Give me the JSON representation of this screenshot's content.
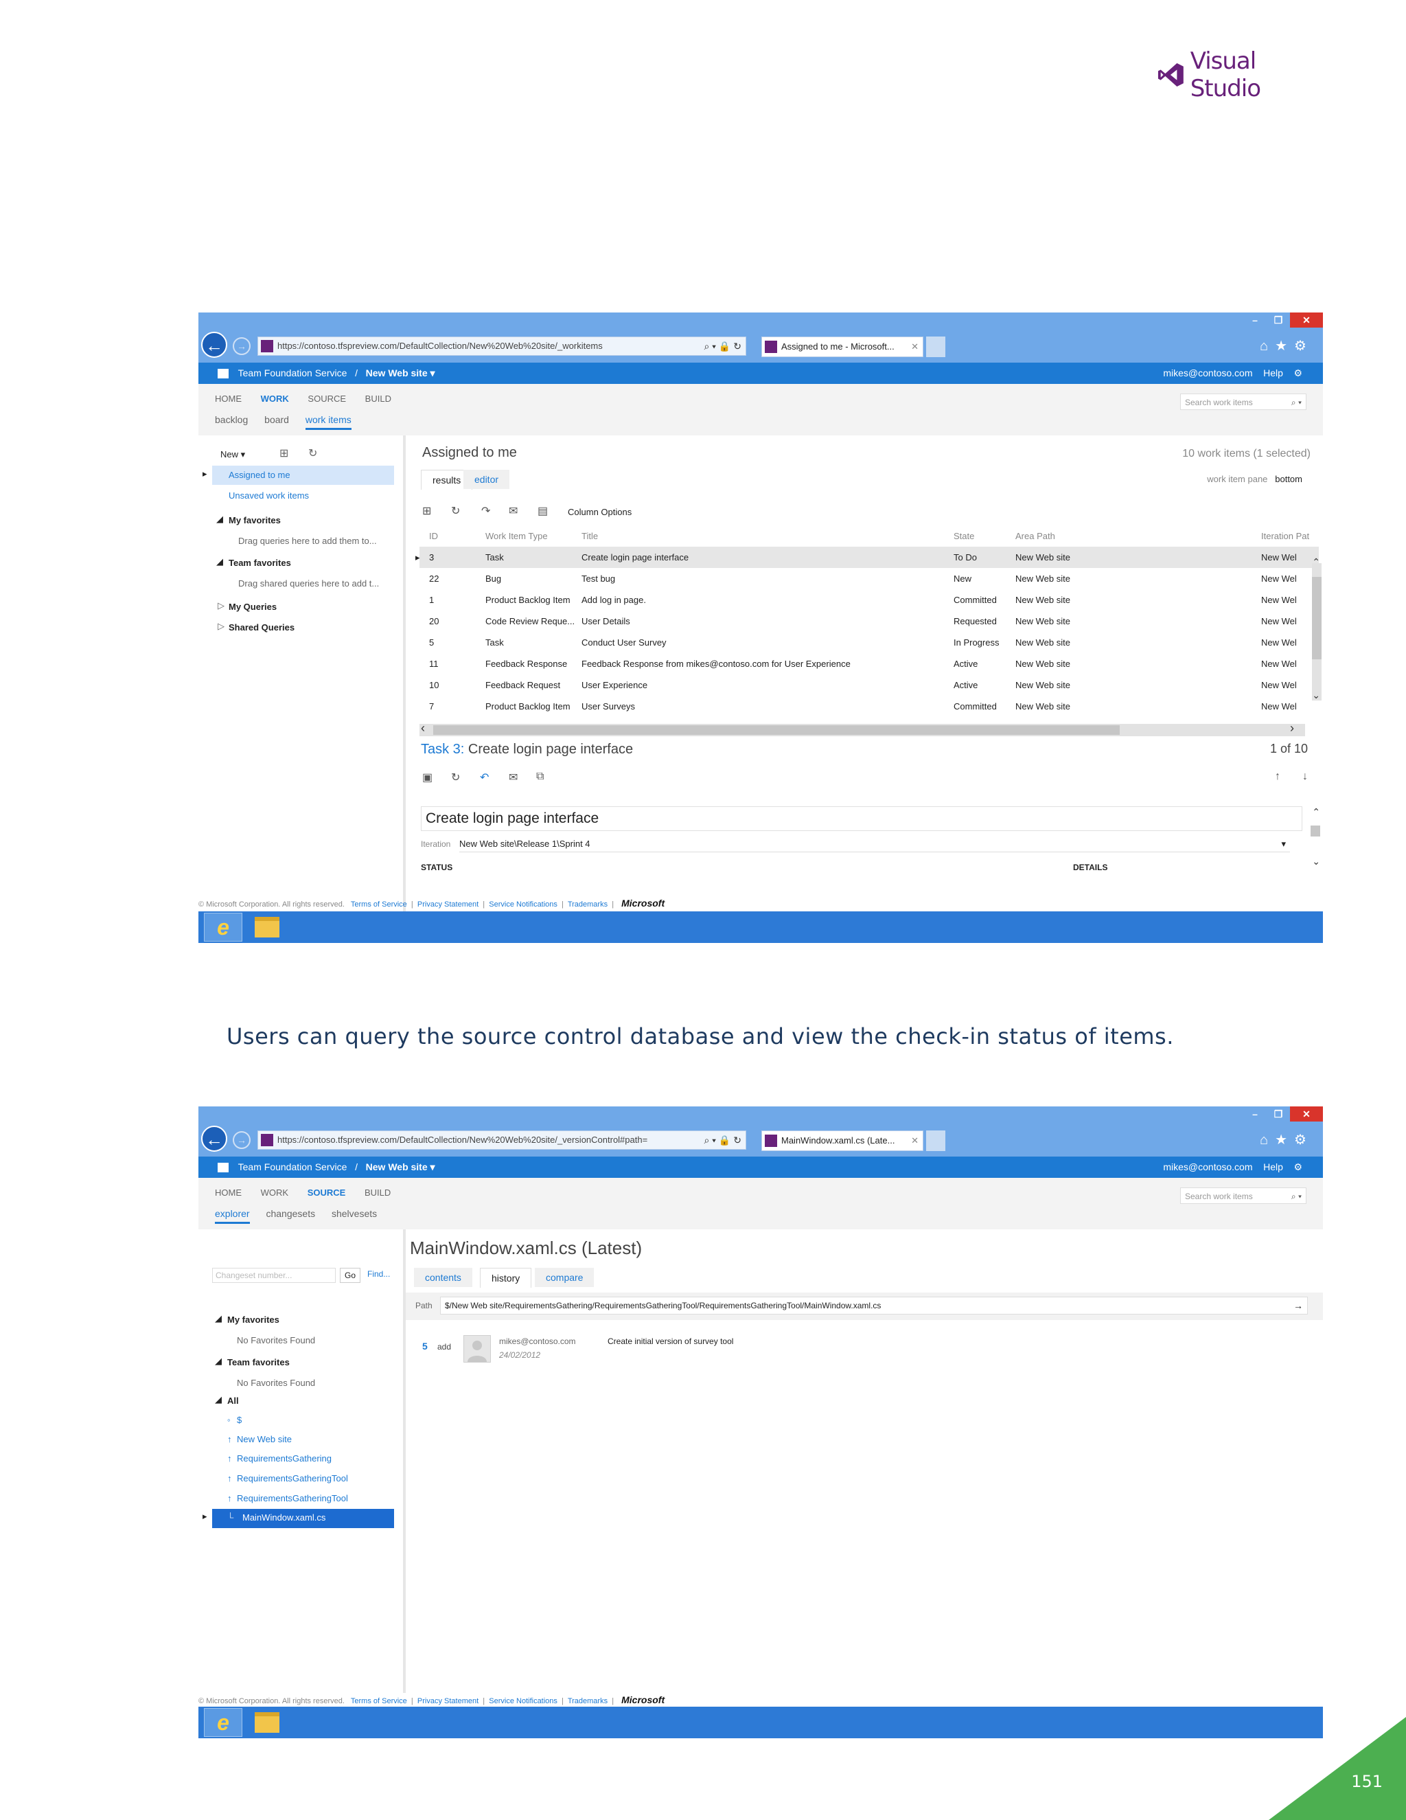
{
  "brand": {
    "name": "Visual Studio",
    "color": "#68217a"
  },
  "caption": "Users can query the source control database and view the check-in status of items.",
  "page_number": "151",
  "colors": {
    "accent": "#1d7ad3",
    "corner": "#4caf50",
    "taskbar": "#2d7ad6"
  },
  "shot1": {
    "address": "https://contoso.tfspreview.com/DefaultCollection/New%20Web%20site/_workitems",
    "tab_title": "Assigned to me - Microsoft...",
    "tfs_title": "Team Foundation Service",
    "sep": "/",
    "project": "New Web site ▾",
    "user": "mikes@contoso.com",
    "help": "Help",
    "topnav": [
      "HOME",
      "WORK",
      "SOURCE",
      "BUILD"
    ],
    "subnav": [
      "backlog",
      "board",
      "work items"
    ],
    "search_placeholder": "Search work items",
    "left": {
      "new_label": "New ▾",
      "assigned": "Assigned to me",
      "unsaved": "Unsaved work items",
      "my_favorites": "My favorites",
      "my_fav_hint": "Drag queries here to add them to...",
      "team_favorites": "Team favorites",
      "team_fav_hint": "Drag shared queries here to add t...",
      "my_queries": "My Queries",
      "shared_queries": "Shared Queries"
    },
    "query_title": "Assigned to me",
    "count_text": "10 work items (1 selected)",
    "tabs": [
      "results",
      "editor"
    ],
    "pane_label": "work item pane",
    "pane_value": "bottom",
    "column_options": "Column Options",
    "columns": [
      "ID",
      "Work Item Type",
      "Title",
      "State",
      "Area Path",
      "Iteration Pat"
    ],
    "rows": [
      [
        "3",
        "Task",
        "Create login page interface",
        "To Do",
        "New Web site",
        "New Wel"
      ],
      [
        "22",
        "Bug",
        "Test bug",
        "New",
        "New Web site",
        "New Wel"
      ],
      [
        "1",
        "Product Backlog Item",
        "Add log in page.",
        "Committed",
        "New Web site",
        "New Wel"
      ],
      [
        "20",
        "Code Review Reque...",
        "User Details",
        "Requested",
        "New Web site",
        "New Wel"
      ],
      [
        "5",
        "Task",
        "Conduct User Survey",
        "In Progress",
        "New Web site",
        "New Wel"
      ],
      [
        "11",
        "Feedback Response",
        "Feedback Response from mikes@contoso.com for User Experience",
        "Active",
        "New Web site",
        "New Wel"
      ],
      [
        "10",
        "Feedback Request",
        "User Experience",
        "Active",
        "New Web site",
        "New Wel"
      ],
      [
        "7",
        "Product Backlog Item",
        "User Surveys",
        "Committed",
        "New Web site",
        "New Wel"
      ]
    ],
    "detail_prefix": "Task 3:",
    "detail_title": "Create login page interface",
    "detail_pos": "1 of 10",
    "field_title": "Create login page interface",
    "iteration_label": "Iteration",
    "iteration_value": "New Web site\\Release 1\\Sprint 4",
    "status_label": "STATUS",
    "details_label": "DETAILS",
    "footer": {
      "copyright": "© Microsoft Corporation. All rights reserved.",
      "links": [
        "Terms of Service",
        "Privacy Statement",
        "Service Notifications",
        "Trademarks"
      ],
      "ms": "Microsoft"
    }
  },
  "shot2": {
    "address": "https://contoso.tfspreview.com/DefaultCollection/New%20Web%20site/_versionControl#path=",
    "tab_title": "MainWindow.xaml.cs (Late...",
    "topnav": [
      "HOME",
      "WORK",
      "SOURCE",
      "BUILD"
    ],
    "subnav": [
      "explorer",
      "changesets",
      "shelvesets"
    ],
    "changeset_placeholder": "Changeset number...",
    "go": "Go",
    "find": "Find...",
    "left": {
      "my_favorites": "My favorites",
      "no_fav1": "No Favorites Found",
      "team_favorites": "Team favorites",
      "no_fav2": "No Favorites Found",
      "all": "All",
      "tree": [
        "$",
        "New Web site",
        "RequirementsGathering",
        "RequirementsGatheringTool",
        "RequirementsGatheringTool",
        "MainWindow.xaml.cs"
      ]
    },
    "file_title": "MainWindow.xaml.cs (Latest)",
    "tabs": [
      "contents",
      "history",
      "compare"
    ],
    "path_label": "Path",
    "path_value": "$/New Web site/RequirementsGathering/RequirementsGatheringTool/RequirementsGatheringTool/MainWindow.xaml.cs",
    "history": {
      "changeset": "5",
      "change": "add",
      "user": "mikes@contoso.com",
      "date": "24/02/2012",
      "comment": "Create initial version of survey tool"
    }
  }
}
